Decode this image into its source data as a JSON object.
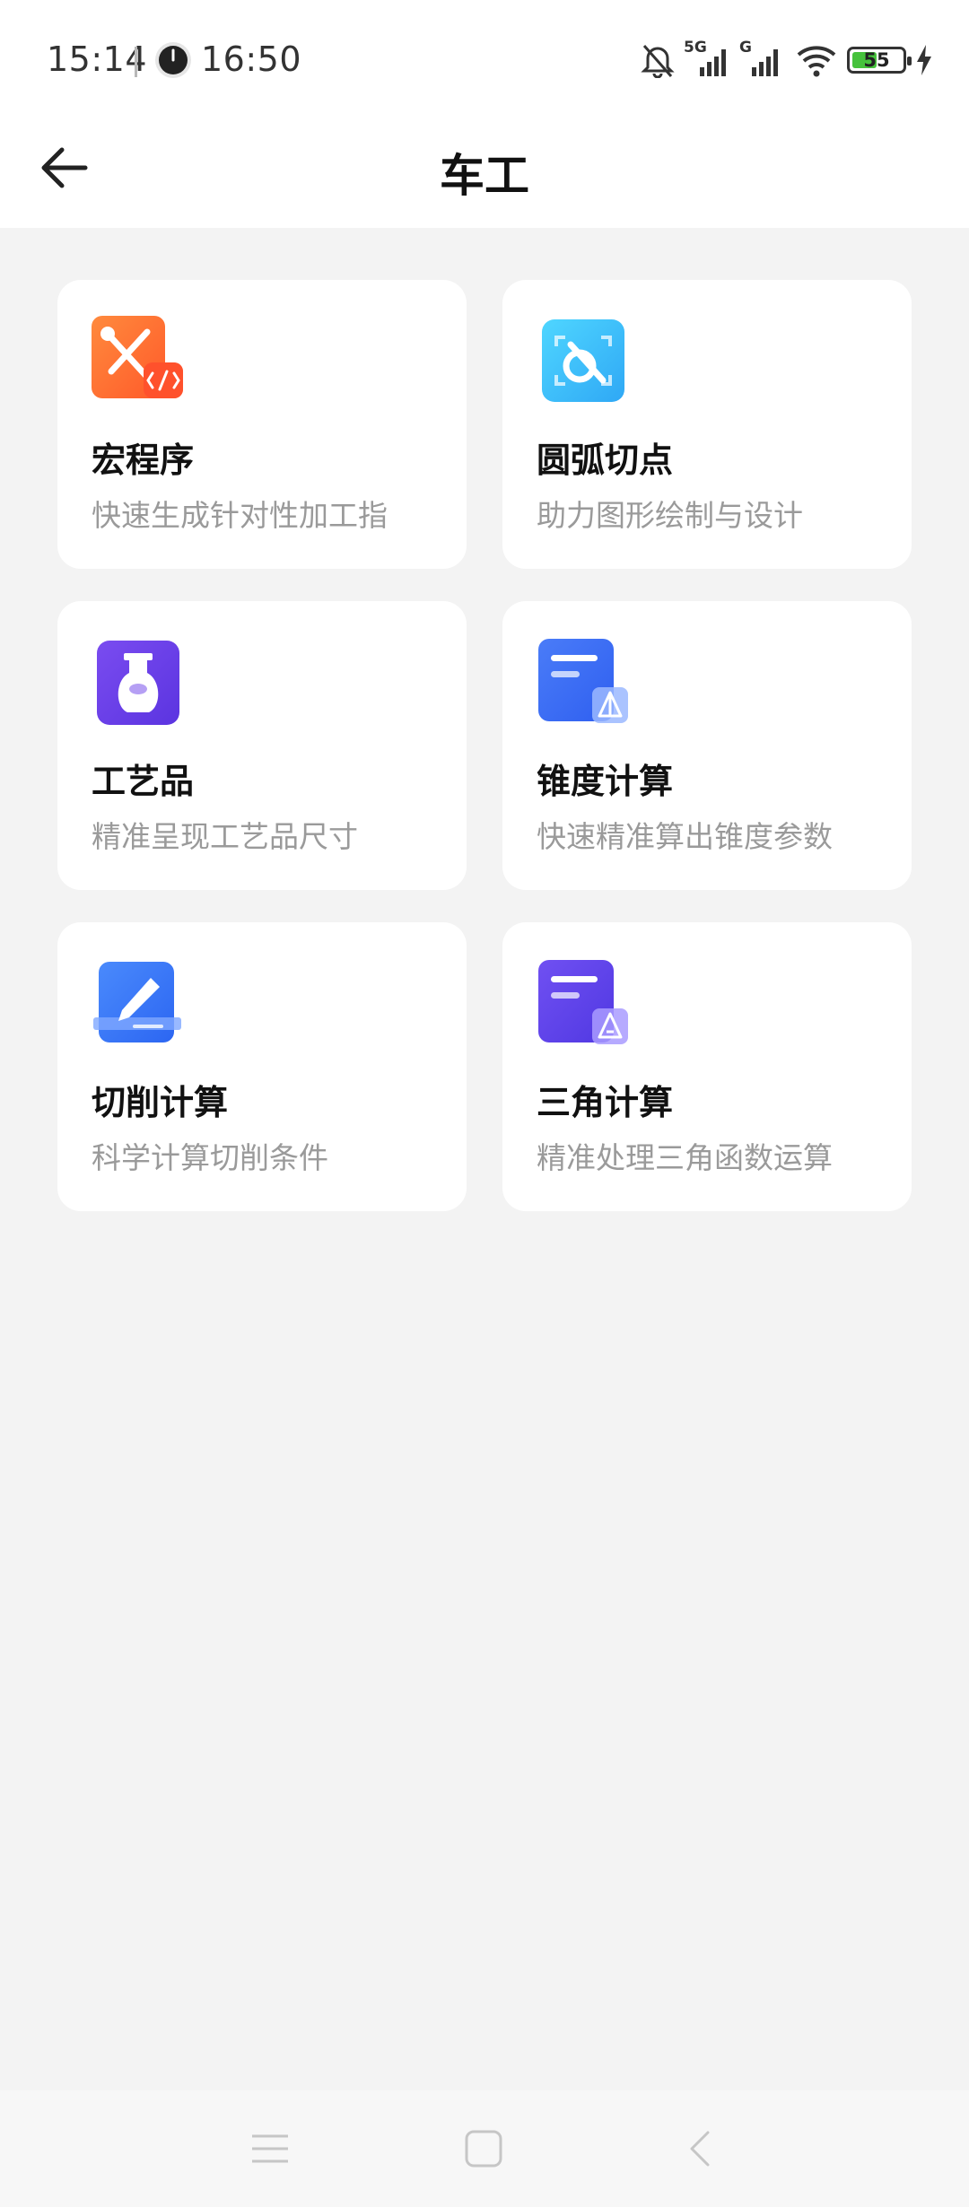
{
  "status_bar": {
    "time": "15:14",
    "secondary_time": "16:50",
    "network_1": "5G",
    "network_2": "G",
    "battery_level": "55",
    "battery_percent": 55
  },
  "header": {
    "title": "车工"
  },
  "cards": [
    {
      "icon": "wrench-code-icon",
      "title": "宏程序",
      "desc": "快速生成针对性加工指"
    },
    {
      "icon": "arc-tangent-icon",
      "title": "圆弧切点",
      "desc": "助力图形绘制与设计"
    },
    {
      "icon": "vase-icon",
      "title": "工艺品",
      "desc": "精准呈现工艺品尺寸"
    },
    {
      "icon": "taper-doc-icon",
      "title": "锥度计算",
      "desc": "快速精准算出锥度参数"
    },
    {
      "icon": "cutting-pen-icon",
      "title": "切削计算",
      "desc": "科学计算切削条件"
    },
    {
      "icon": "triangle-doc-icon",
      "title": "三角计算",
      "desc": "精准处理三角函数运算"
    }
  ],
  "colors": {
    "background": "#f3f3f3",
    "card": "#ffffff",
    "title_text": "#111111",
    "desc_text": "#9a9a9a"
  }
}
